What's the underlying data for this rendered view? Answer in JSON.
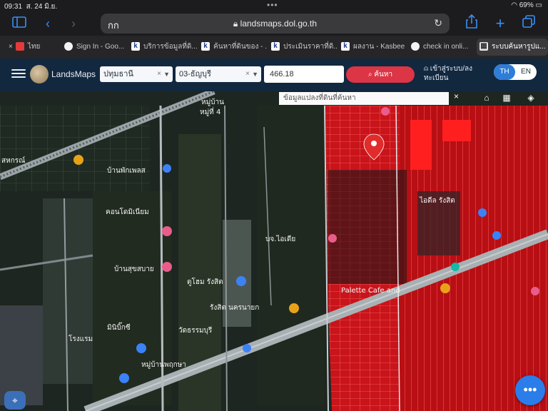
{
  "status_bar": {
    "time": "09:31",
    "date": "ส. 24 มิ.ย.",
    "battery": "69%"
  },
  "browser": {
    "reader_label": "กก",
    "url": "landsmaps.dol.go.th",
    "tabs": [
      {
        "label": "ไทย",
        "favicon": "red-icon"
      },
      {
        "label": "Sign In - Goo...",
        "favicon": "google-icon"
      },
      {
        "label": "บริการข้อมูลที่ดิ...",
        "favicon": "k"
      },
      {
        "label": "ค้นหาที่ดินของ - ...",
        "favicon": "k"
      },
      {
        "label": "ประเมินราคาที่ดิ...",
        "favicon": "k"
      },
      {
        "label": "ผลงาน - Kasbee",
        "favicon": "k"
      },
      {
        "label": "check in onli...",
        "favicon": "google-icon"
      },
      {
        "label": "ระบบค้นหารูปแ...",
        "favicon": "grid-icon"
      }
    ]
  },
  "app": {
    "brand": "LandsMaps",
    "province": "ปทุมธานี",
    "district": "03-ธัญบุรี",
    "parcel_number": "466.18",
    "search_label": "ค้นหา",
    "login_label": "เข้าสู่ระบบ/ลงทะเบียน",
    "lang_th": "TH",
    "lang_en": "EN"
  },
  "map": {
    "popup_text": "ข้อมูลแปลงที่ดินที่ค้นหา",
    "place_labels": [
      "หมู่บ้าน",
      "หมู่ที่ 4",
      "บ้านพักเพลส",
      "สหกรณ์",
      "คอนโดมิเนียม",
      "บ้านสุขสบาย",
      "ตูโฮม รังสิต",
      "รังสิต นครนายก",
      "วัดธรรมบุรี",
      "หมู่บ้านพฤกษา",
      "บจ.ไอเดีย",
      "Palette Cafe and",
      "มินิบิ๊กซี",
      "โรงแรม",
      "ไอดีล รังสิต"
    ]
  }
}
